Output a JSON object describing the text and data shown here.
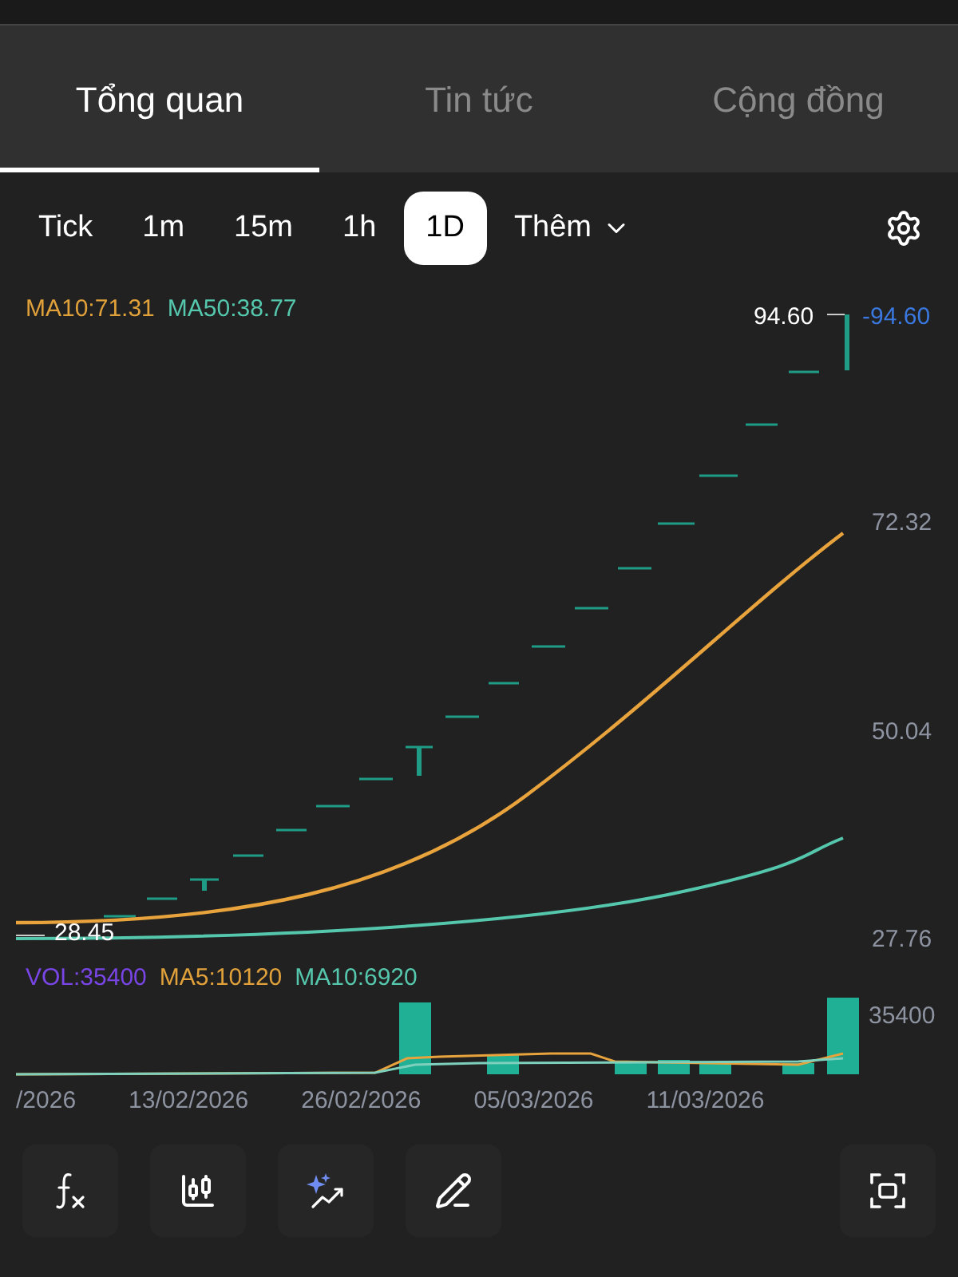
{
  "tabs": [
    {
      "label": "Tổng quan",
      "selected": true
    },
    {
      "label": "Tin tức",
      "selected": false
    },
    {
      "label": "Cộng đồng",
      "selected": false
    }
  ],
  "intervals": [
    {
      "label": "Tick",
      "selected": false,
      "kind": "plain"
    },
    {
      "label": "1m",
      "selected": false,
      "kind": "plain"
    },
    {
      "label": "15m",
      "selected": false,
      "kind": "plain"
    },
    {
      "label": "1h",
      "selected": false,
      "kind": "plain"
    },
    {
      "label": "1D",
      "selected": true,
      "kind": "plain"
    },
    {
      "label": "Thêm",
      "selected": false,
      "kind": "dropdown"
    }
  ],
  "price_chart": {
    "legend": [
      {
        "label": "MA10:71.31",
        "color": "#e0a03a"
      },
      {
        "label": "MA50:38.77",
        "color": "#55c7ad"
      }
    ],
    "high_label": "94.60",
    "current_price": "-94.60",
    "low_label": "28.45",
    "axis_labels": [
      "72.32",
      "50.04",
      "27.76"
    ]
  },
  "volume_chart": {
    "legend": [
      {
        "label": "VOL:35400",
        "color": "#7a45e6"
      },
      {
        "label": "MA5:10120",
        "color": "#e0a03a"
      },
      {
        "label": "MA10:6920",
        "color": "#55c7ad"
      }
    ],
    "axis_label": "35400"
  },
  "dates": [
    "/2026",
    "13/02/2026",
    "26/02/2026",
    "05/03/2026",
    "11/03/2026"
  ]
}
